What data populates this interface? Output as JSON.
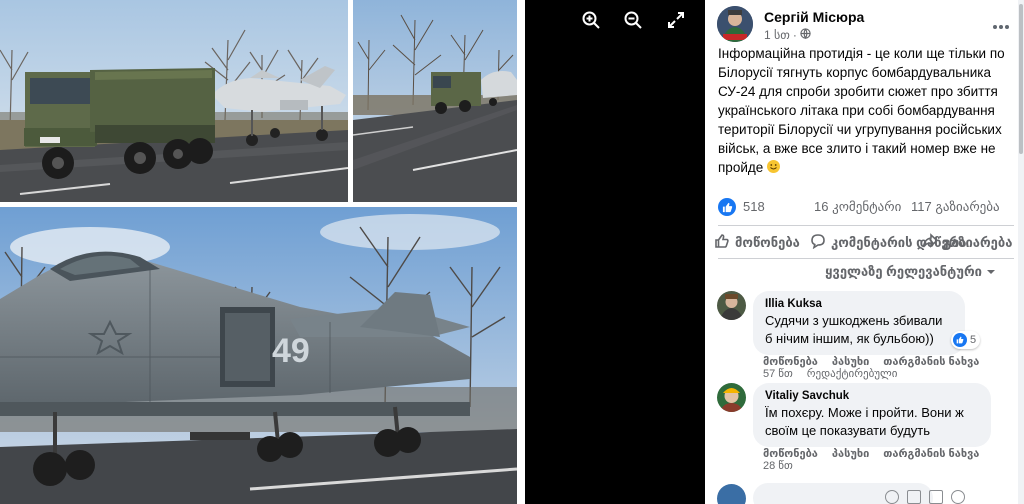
{
  "viewer": {
    "zoom_in_icon": "zoom-in-icon",
    "zoom_out_icon": "zoom-out-icon",
    "fullscreen_icon": "expand-icon"
  },
  "post": {
    "author": "Сергій Місюра",
    "time": "1 სთ",
    "audience_icon": "globe-icon",
    "text": "Інформаційна протидія - це коли ще тільки по Білорусії тягнуть корпус бомбардувальника СУ-24 для спроби зробити сюжет про збиття українського літака при собі бомбардування території Білорусії чи угрупування російських військ, а вже все злито і такий номер вже не пройде",
    "stats": {
      "likes": "518",
      "comments": "16 კომენტარი",
      "shares": "117 გაზიარება"
    },
    "actions": {
      "like": "მოწონება",
      "comment": "კომენტარის დაწერა",
      "share": "გაზიარება"
    },
    "sort_label": "ყველაზე რელევანტური"
  },
  "comments": [
    {
      "name": "Illia Kuksa",
      "text_line1": "Судячи з ушкоджень збивали",
      "text_line2": "б нічим іншим, як бульбою))",
      "reactions": "5",
      "actions": [
        "მოწონება",
        "პასუხი",
        "თარგმანის ნახვა"
      ],
      "time": "57 წთ",
      "edited": "რედაქტირებული"
    },
    {
      "name": "Vitaliy Savchuk",
      "text_line1": "Їм похєру. Може і пройти. Вони ж",
      "text_line2": "своїм це показувати будуть",
      "actions": [
        "მოწონება",
        "პასუხი",
        "თარგმანის ნახვა"
      ],
      "time": "28 წთ"
    }
  ],
  "photos": {
    "tail_number": "49"
  },
  "colors": {
    "accent": "#1877f2",
    "viewer_bg": "#000000",
    "bubble": "#f0f2f5"
  }
}
